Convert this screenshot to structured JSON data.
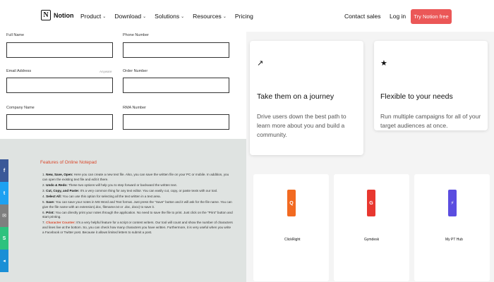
{
  "nav": {
    "logo_text": "Notion",
    "menu": [
      {
        "label": "Product",
        "chevron": true
      },
      {
        "label": "Download",
        "chevron": true
      },
      {
        "label": "Solutions",
        "chevron": true
      },
      {
        "label": "Resources",
        "chevron": true
      },
      {
        "label": "Pricing",
        "chevron": false
      }
    ],
    "contact_sales": "Contact sales",
    "login": "Log in",
    "cta": "Try Notion free"
  },
  "form": {
    "full_name": "Full Name",
    "phone": "Phone Number",
    "email": "Email Address",
    "email_hint": "Anyware",
    "order": "Order Number",
    "company": "Company Name",
    "rma": "RMA Number"
  },
  "notepad": {
    "title": "Features of Online Notepad",
    "items": [
      {
        "n": "1.",
        "head": "New, Save, Open:",
        "text": "Here you can create a new text file. Also, you can save the written file on your PC or mobile. In addition, you can open the existing text file and edit it there."
      },
      {
        "n": "2.",
        "head": "Undo & Redo:",
        "text": "These two options will help you to step forward or backward the written text."
      },
      {
        "n": "3.",
        "head": "Cut, Copy, and Paste:",
        "text": "It's a very common thing for any text editor. You can easily cut, copy, or paste texts with our tool."
      },
      {
        "n": "4.",
        "head": "Select All:",
        "text": "You can use this option for selecting all the text written in a text area."
      },
      {
        "n": "5.",
        "head": "Save:",
        "text": "You can save your notes in MS Word and Text format. Just press the \"Save\" button and it will ask for the file name. You can give the file name with an extension(.doc, filename.txt or .doc, docx) to save it."
      },
      {
        "n": "6.",
        "head": "Print:",
        "text": "You can directly print your notes through the application. No need to save the file to print. Just click on the \"Print\" button and start printing."
      },
      {
        "n": "7.",
        "head": "Character Counter:",
        "text": "It's a very helpful feature for a script or content writers. Our tool will count and show the number of characters and lines live at the bottom. So, you can check how many characters you have written. Furthermore, it is very useful when you write a Facebook or Twitter post. Because it allows limited letters to submit a post."
      }
    ]
  },
  "share_buttons": [
    {
      "icon": "facebook-icon",
      "glyph": "f",
      "color": "#3b5998"
    },
    {
      "icon": "twitter-icon",
      "glyph": "t",
      "color": "#1da1f2"
    },
    {
      "icon": "email-icon",
      "glyph": "✉",
      "color": "#7f7f7f"
    },
    {
      "icon": "sharethis-icon",
      "glyph": "S",
      "color": "#2ec27e"
    },
    {
      "icon": "share-icon",
      "glyph": "◂",
      "color": "#1a8fd6"
    }
  ],
  "cards": [
    {
      "icon": "arrow-trend-icon",
      "glyph": "↗",
      "title": "Take them on a journey",
      "body": "Drive users down the best path to learn more about you and build a community."
    },
    {
      "icon": "star-icon",
      "glyph": "★",
      "title": "Flexible to your needs",
      "body": "Run multiple campaigns for all of your target audiences at once."
    }
  ],
  "tiles": [
    {
      "label": "ClickRight",
      "color": "#f26a21",
      "glyph": "Q"
    },
    {
      "label": "Gymdesk",
      "color": "#e8372f",
      "glyph": "G"
    },
    {
      "label": "My PT Hub",
      "color": "#5b4de0",
      "glyph": "⚡"
    }
  ]
}
